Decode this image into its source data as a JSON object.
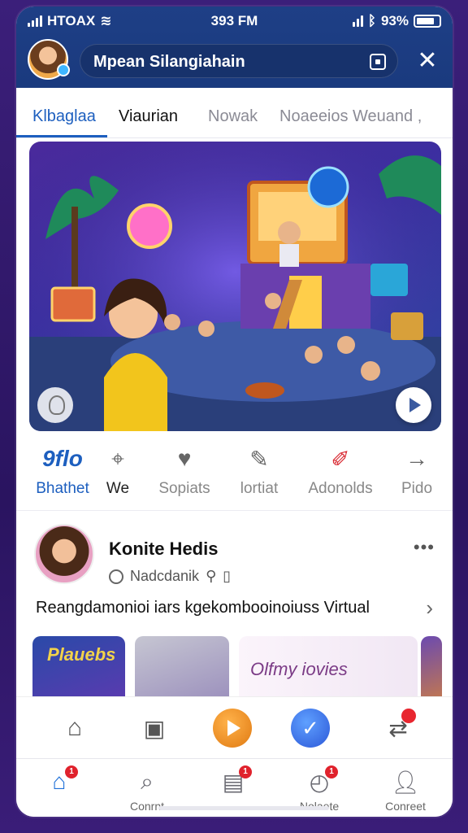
{
  "status_bar": {
    "carrier": "HTOAX",
    "time": "393 FM",
    "battery": "93%"
  },
  "header": {
    "search_value": "Mpean Silangiahain"
  },
  "tabs": [
    "Klbaglaa",
    "Viaurian",
    "Nowak",
    "Noaeeios",
    "Weuand ,"
  ],
  "actions": [
    {
      "icon": "9flo",
      "label": "Bhathet"
    },
    {
      "icon": "pin-icon",
      "label": "We"
    },
    {
      "icon": "heart-icon",
      "label": "Sopiats"
    },
    {
      "icon": "feather-icon",
      "label": "lortiat"
    },
    {
      "icon": "pen-icon",
      "label": "Adonolds"
    },
    {
      "icon": "arrow-right-icon",
      "label": "Pido"
    }
  ],
  "post": {
    "name": "Konite Hedis",
    "sub": "Nadcdanik",
    "text": "Reangdamonioi iars kgekombooinoiuss Virtual"
  },
  "thumbnails": {
    "t1_text": "Plauebs",
    "t3_text": "Olfmy iovies"
  },
  "bottom_nav": [
    {
      "label": ""
    },
    {
      "label": "Conrnt"
    },
    {
      "label": ""
    },
    {
      "label": "Nolaete"
    },
    {
      "label": "Conreet"
    }
  ],
  "colors": {
    "accent": "#1d5fbf",
    "header_bg": "#1e3f86",
    "badge": "#e0222c"
  }
}
